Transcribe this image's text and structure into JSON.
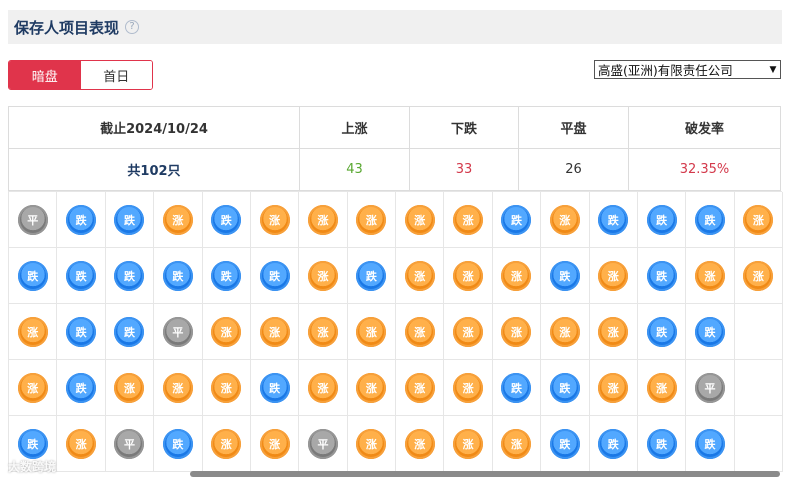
{
  "header": {
    "title": "保存人项目表现",
    "help_icon": "help-circle-icon"
  },
  "toggle": {
    "dark_label": "暗盘",
    "first_day_label": "首日",
    "active": "dark"
  },
  "firm_select": {
    "value": "高盛(亚洲)有限责任公司"
  },
  "summary": {
    "date_header": "截止2024/10/24",
    "up_header": "上涨",
    "down_header": "下跌",
    "flat_header": "平盘",
    "rate_header": "破发率",
    "total": "共102只",
    "up": "43",
    "down": "33",
    "flat": "26",
    "rate": "32.35%"
  },
  "coin_labels": {
    "up": "涨",
    "down": "跌",
    "flat": "平"
  },
  "colors": {
    "accent": "#e0344b",
    "up_coin": "#f08a16",
    "down_coin": "#1a78e6",
    "flat_coin": "#7a7a7a",
    "up_text": "#5aa832",
    "down_text": "#d3394b"
  },
  "grid_rows": [
    [
      "flat",
      "down",
      "down",
      "up",
      "down",
      "up",
      "up",
      "up",
      "up",
      "up",
      "down",
      "up",
      "down",
      "down",
      "down",
      "up"
    ],
    [
      "down",
      "down",
      "down",
      "down",
      "down",
      "down",
      "up",
      "down",
      "up",
      "up",
      "up",
      "down",
      "up",
      "down",
      "up",
      "up"
    ],
    [
      "up",
      "down",
      "down",
      "flat",
      "up",
      "up",
      "up",
      "up",
      "up",
      "up",
      "up",
      "up",
      "up",
      "down",
      "down",
      ""
    ],
    [
      "up",
      "down",
      "up",
      "up",
      "up",
      "down",
      "up",
      "up",
      "up",
      "up",
      "down",
      "down",
      "up",
      "up",
      "flat",
      ""
    ],
    [
      "down",
      "up",
      "flat",
      "down",
      "up",
      "up",
      "flat",
      "up",
      "up",
      "up",
      "up",
      "down",
      "down",
      "down",
      "down",
      ""
    ]
  ],
  "watermark": "大数跨境"
}
